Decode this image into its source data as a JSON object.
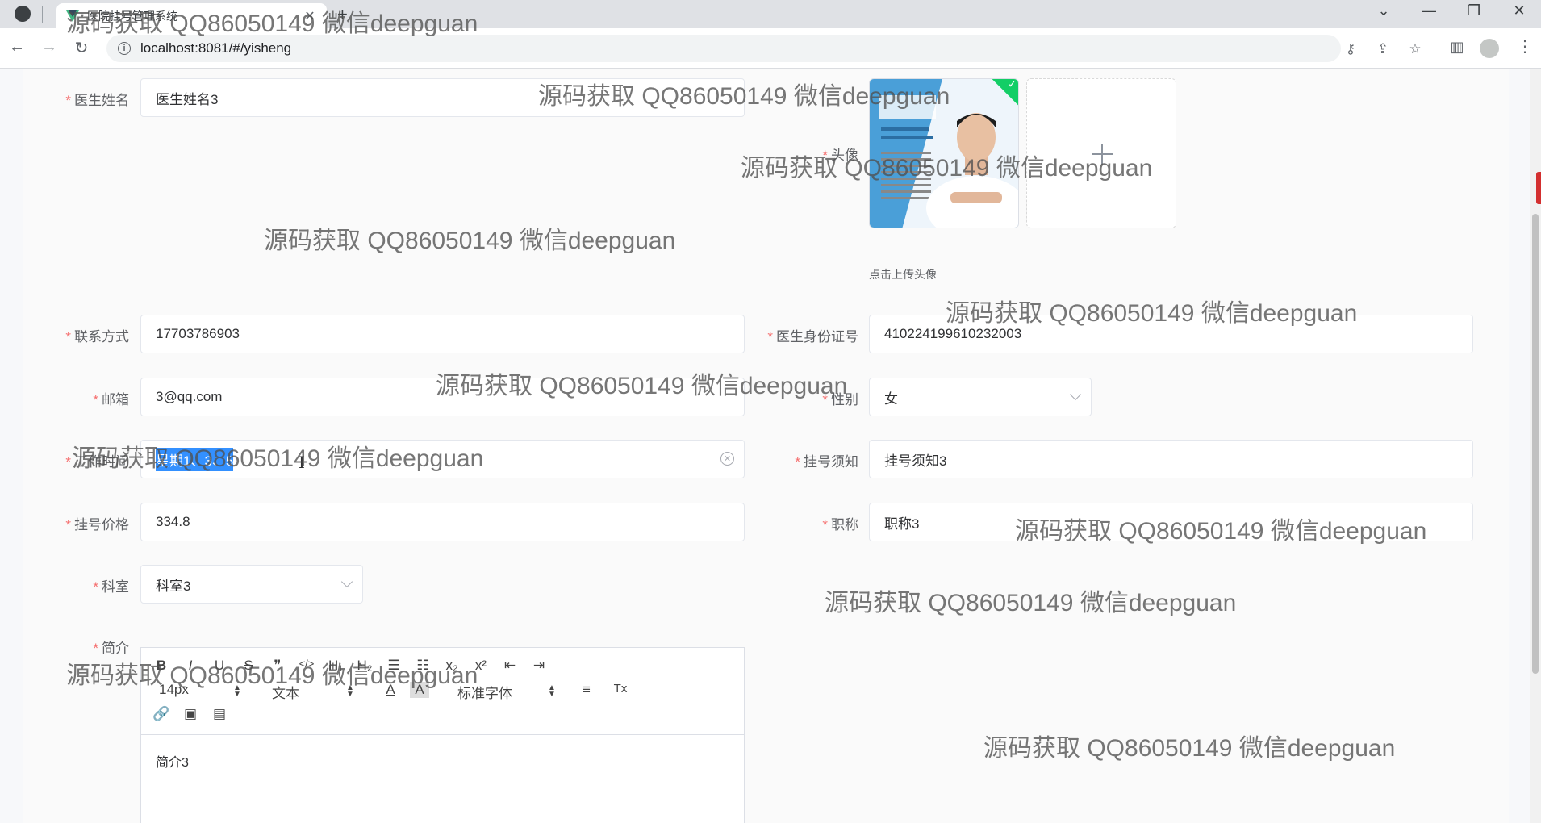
{
  "browser": {
    "tab_title": "医院挂号管理系统",
    "tab_close": "✕",
    "new_tab": "+",
    "url": "localhost:8081/#/yisheng"
  },
  "form": {
    "doctor_name": {
      "label": "医生姓名",
      "value": "医生姓名3"
    },
    "avatar": {
      "label": "头像",
      "hint": "点击上传头像"
    },
    "phone": {
      "label": "联系方式",
      "value": "17703786903"
    },
    "id_card": {
      "label": "医生身份证号",
      "value": "410224199610232003"
    },
    "email": {
      "label": "邮箱",
      "value": "3@qq.com"
    },
    "gender": {
      "label": "性别",
      "value": "女"
    },
    "work_time": {
      "label": "工作时间",
      "value": "星期1、3、5"
    },
    "notice": {
      "label": "挂号须知",
      "value": "挂号须知3"
    },
    "price": {
      "label": "挂号价格",
      "value": "334.8"
    },
    "title": {
      "label": "职称",
      "value": "职称3"
    },
    "department": {
      "label": "科室",
      "value": "科室3"
    },
    "intro": {
      "label": "简介",
      "content": "简介3"
    },
    "required_mark": "*"
  },
  "editor_toolbar": {
    "bold": "B",
    "italic": "I",
    "underline": "U",
    "strike": "S",
    "quote": "❞",
    "code": "</>",
    "h1": "H₁",
    "h2": "H₂",
    "ordered_list": "☰",
    "bullet_list": "☷",
    "subscript": "x₂",
    "superscript": "x²",
    "outdent": "⇤",
    "indent": "⇥",
    "font_size": "14px",
    "block_type": "文本",
    "font_family": "标准字体",
    "text_color": "A",
    "bg_color": "A",
    "align": "≡",
    "clear_format": "Tx",
    "link": "🔗",
    "image": "▣",
    "video": "▤"
  },
  "watermark_text": "源码获取 QQ86050149 微信deepguan"
}
